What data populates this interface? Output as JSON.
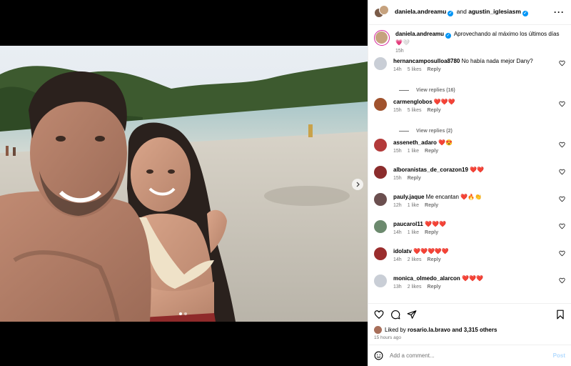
{
  "header": {
    "user1": "daniela.andreamu",
    "and": "and",
    "user2": "agustin_iglesiasm",
    "more_icon": "more-horizontal-icon"
  },
  "caption": {
    "username": "daniela.andreamu",
    "text": "Aprovechando al máximo los últimos días",
    "emojis": "💗🤍",
    "time": "15h"
  },
  "comments": [
    {
      "username": "hernancamposulloa8780",
      "text": "No había nada mejor Dany?",
      "time": "14h",
      "likes": "5 likes",
      "reply": "Reply",
      "view_replies": "View replies (16)",
      "avatar": "#c9ced6"
    },
    {
      "username": "carmenglobos",
      "text": "❤️❤️❤️",
      "time": "15h",
      "likes": "5 likes",
      "reply": "Reply",
      "view_replies": "View replies (2)",
      "avatar": "#a0522d"
    },
    {
      "username": "asseneth_adaro",
      "text": "❤️😍",
      "time": "15h",
      "likes": "1 like",
      "reply": "Reply",
      "avatar": "#b33a3a"
    },
    {
      "username": "alboranistas_de_corazon19",
      "text": "❤️❤️",
      "time": "15h",
      "likes": "",
      "reply": "Reply",
      "avatar": "#8b2c2c"
    },
    {
      "username": "pauly.jaque",
      "text": "Me encantan ❤️🔥👏",
      "time": "12h",
      "likes": "1 like",
      "reply": "Reply",
      "avatar": "#6b4f4f"
    },
    {
      "username": "paucarol11",
      "text": "❤️❤️❤️",
      "time": "14h",
      "likes": "1 like",
      "reply": "Reply",
      "avatar": "#6c8a6e"
    },
    {
      "username": "idolatv",
      "text": "❤️❤️❤️❤️❤️",
      "time": "14h",
      "likes": "2 likes",
      "reply": "Reply",
      "avatar": "#9a2d2d"
    },
    {
      "username": "monica_olmedo_alarcon",
      "text": "❤️❤️❤️",
      "time": "13h",
      "likes": "2 likes",
      "reply": "Reply",
      "avatar": "#c9ced6"
    }
  ],
  "liked_by": {
    "prefix": "Liked by",
    "user": "rosario.la.bravo",
    "rest": "and 3,315 others"
  },
  "posted_ago": "15 hours ago",
  "add_comment": {
    "placeholder": "Add a comment...",
    "post": "Post"
  },
  "carousel": {
    "current": 1,
    "total": 2
  },
  "colors": {
    "verified": "#0095f6",
    "link_blue_disabled": "#b3dbff",
    "secondary_text": "#737373"
  }
}
